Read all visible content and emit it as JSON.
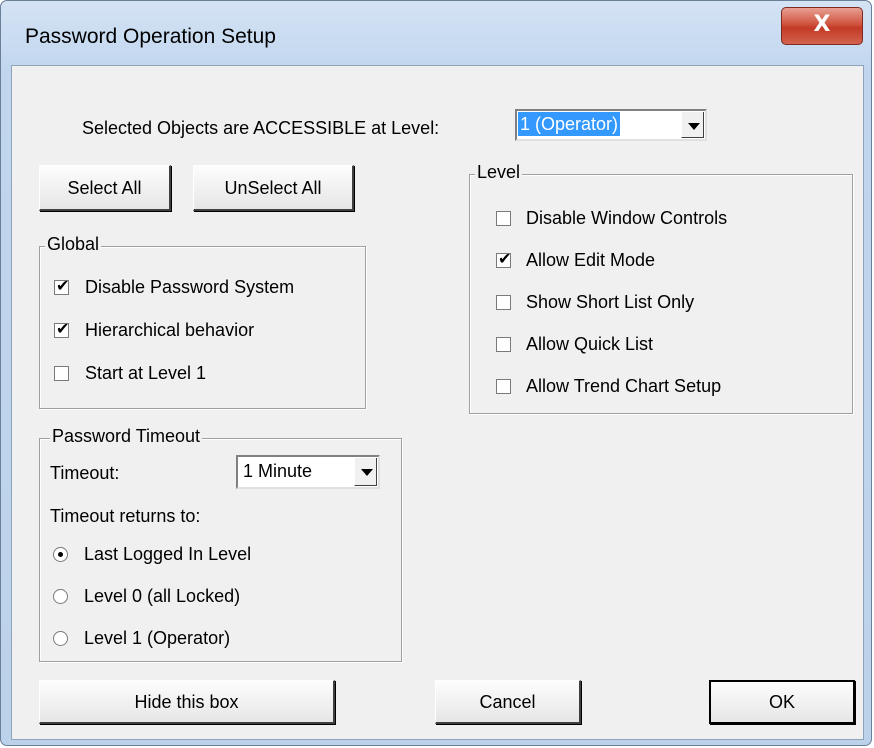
{
  "window": {
    "title": "Password Operation Setup",
    "close_label": "X"
  },
  "access": {
    "label": "Selected Objects are ACCESSIBLE at Level:",
    "value": "1 (Operator)"
  },
  "buttons": {
    "select_all": "Select All",
    "unselect_all": "UnSelect All",
    "hide": "Hide this box",
    "cancel": "Cancel",
    "ok": "OK"
  },
  "global": {
    "legend": "Global",
    "items": [
      {
        "label": "Disable Password System",
        "checked": true
      },
      {
        "label": "Hierarchical behavior",
        "checked": true
      },
      {
        "label": "Start at Level 1",
        "checked": false
      }
    ]
  },
  "level": {
    "legend": "Level",
    "items": [
      {
        "label": "Disable Window Controls",
        "checked": false
      },
      {
        "label": "Allow Edit Mode",
        "checked": true
      },
      {
        "label": "Show Short List Only",
        "checked": false
      },
      {
        "label": "Allow Quick List",
        "checked": false
      },
      {
        "label": "Allow Trend Chart Setup",
        "checked": false
      }
    ]
  },
  "timeout": {
    "legend": "Password Timeout",
    "label": "Timeout:",
    "value": "1 Minute",
    "returns_label": "Timeout returns to:",
    "options": [
      {
        "label": "Last Logged In Level",
        "selected": true
      },
      {
        "label": "Level 0 (all Locked)",
        "selected": false
      },
      {
        "label": "Level 1 (Operator)",
        "selected": false
      }
    ]
  },
  "check_mark": "✔"
}
